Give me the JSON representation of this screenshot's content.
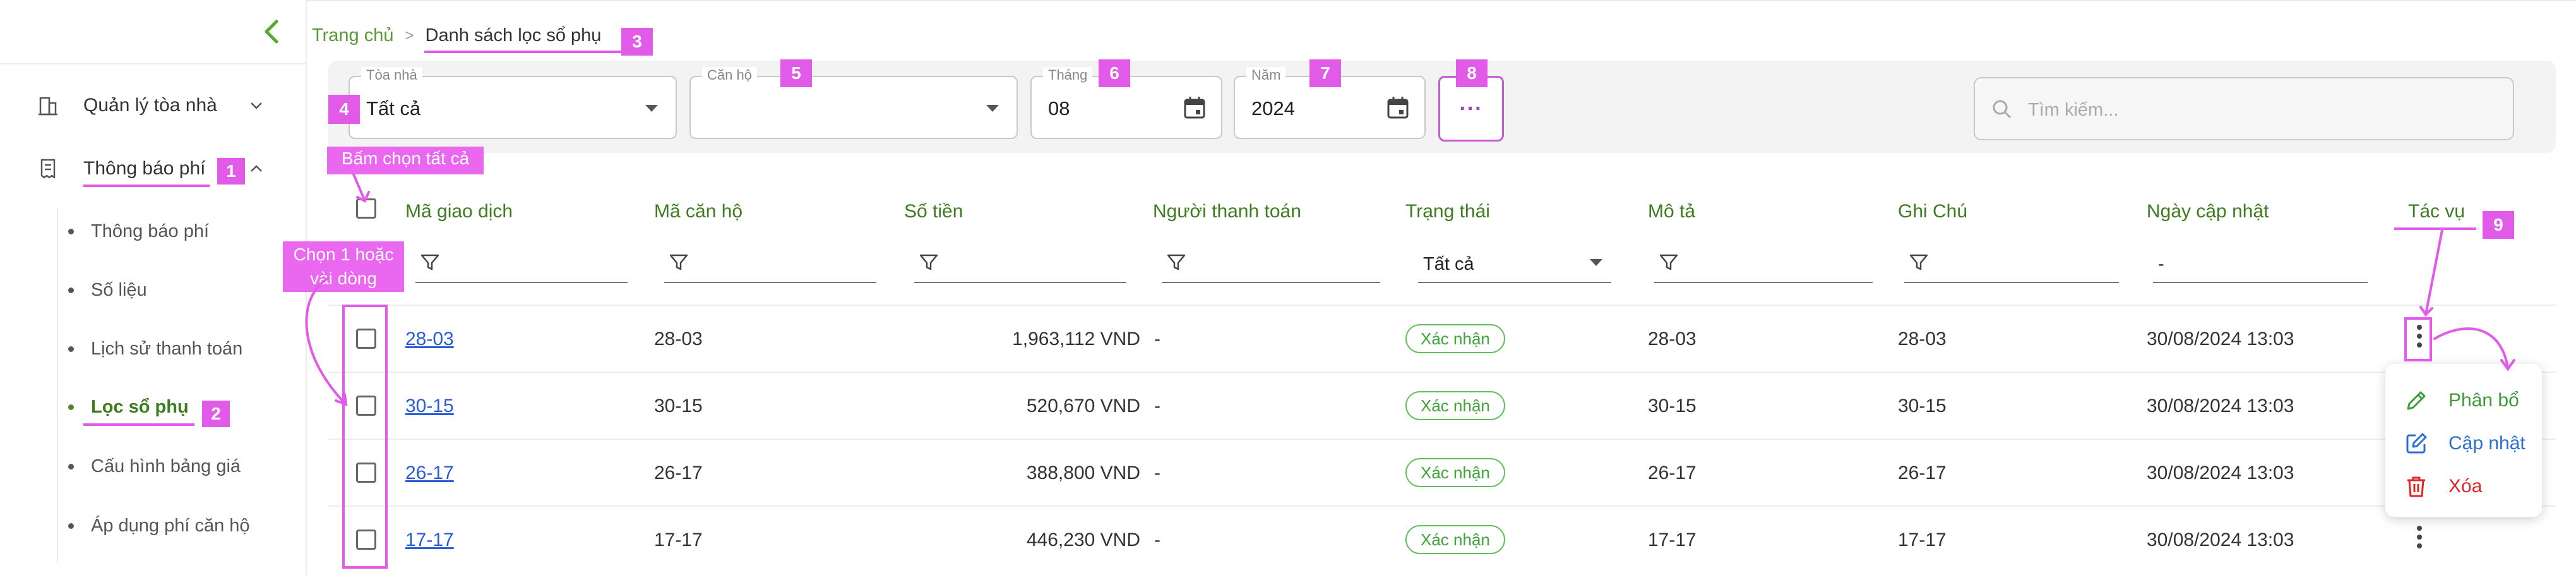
{
  "sidebar": {
    "items": [
      {
        "label": "Quản lý tòa nhà"
      },
      {
        "label": "Thông báo phí"
      }
    ],
    "subitems": [
      {
        "label": "Thông báo phí"
      },
      {
        "label": "Số liệu"
      },
      {
        "label": "Lịch sử thanh toán"
      },
      {
        "label": "Lọc sổ phụ"
      },
      {
        "label": "Cấu hình bảng giá"
      },
      {
        "label": "Áp dụng phí căn hộ"
      }
    ]
  },
  "breadcrumb": {
    "home": "Trang chủ",
    "separator": ">",
    "current": "Danh sách lọc sổ phụ"
  },
  "filters": {
    "building": {
      "label": "Tòa nhà",
      "value": "Tất cả"
    },
    "apartment": {
      "label": "Căn hộ",
      "value": ""
    },
    "month": {
      "label": "Tháng",
      "value": "08"
    },
    "year": {
      "label": "Năm",
      "value": "2024"
    },
    "more": "···",
    "search_placeholder": "Tìm kiếm..."
  },
  "table": {
    "columns": [
      "Mã giao dịch",
      "Mã căn hộ",
      "Số tiền",
      "Người thanh toán",
      "Trạng thái",
      "Mô tả",
      "Ghi Chú",
      "Ngày cập nhật",
      "Tác vụ"
    ],
    "status_filter": "Tất cả",
    "date_filter": "-",
    "rows": [
      {
        "code": "28-03",
        "apartment": "28-03",
        "amount": "1,963,112 VND",
        "payer": "-",
        "status": "Xác nhận",
        "description": "28-03",
        "note": "28-03",
        "updated": "30/08/2024 13:03"
      },
      {
        "code": "30-15",
        "apartment": "30-15",
        "amount": "520,670 VND",
        "payer": "-",
        "status": "Xác nhận",
        "description": "30-15",
        "note": "30-15",
        "updated": "30/08/2024 13:03"
      },
      {
        "code": "26-17",
        "apartment": "26-17",
        "amount": "388,800 VND",
        "payer": "-",
        "status": "Xác nhận",
        "description": "26-17",
        "note": "26-17",
        "updated": "30/08/2024 13:03"
      },
      {
        "code": "17-17",
        "apartment": "17-17",
        "amount": "446,230 VND",
        "payer": "-",
        "status": "Xác nhận",
        "description": "17-17",
        "note": "17-17",
        "updated": "30/08/2024 13:03"
      }
    ]
  },
  "action_menu": {
    "items": [
      {
        "label": "Phân bổ",
        "color": "#3e9a3a"
      },
      {
        "label": "Cập nhật",
        "color": "#2a6fd6"
      },
      {
        "label": "Xóa",
        "color": "#e02424"
      }
    ]
  },
  "annotations": {
    "tags": [
      "1",
      "2",
      "3",
      "4",
      "5",
      "6",
      "7",
      "8",
      "9"
    ],
    "select_all": "Bấm chọn tất cả",
    "select_rows": "Chọn 1 hoặc vài dòng"
  },
  "colors": {
    "accent": "#3e7d1f",
    "annotation": "#e25be8",
    "link": "#2a5bd7",
    "badge": "#3fa53a"
  }
}
